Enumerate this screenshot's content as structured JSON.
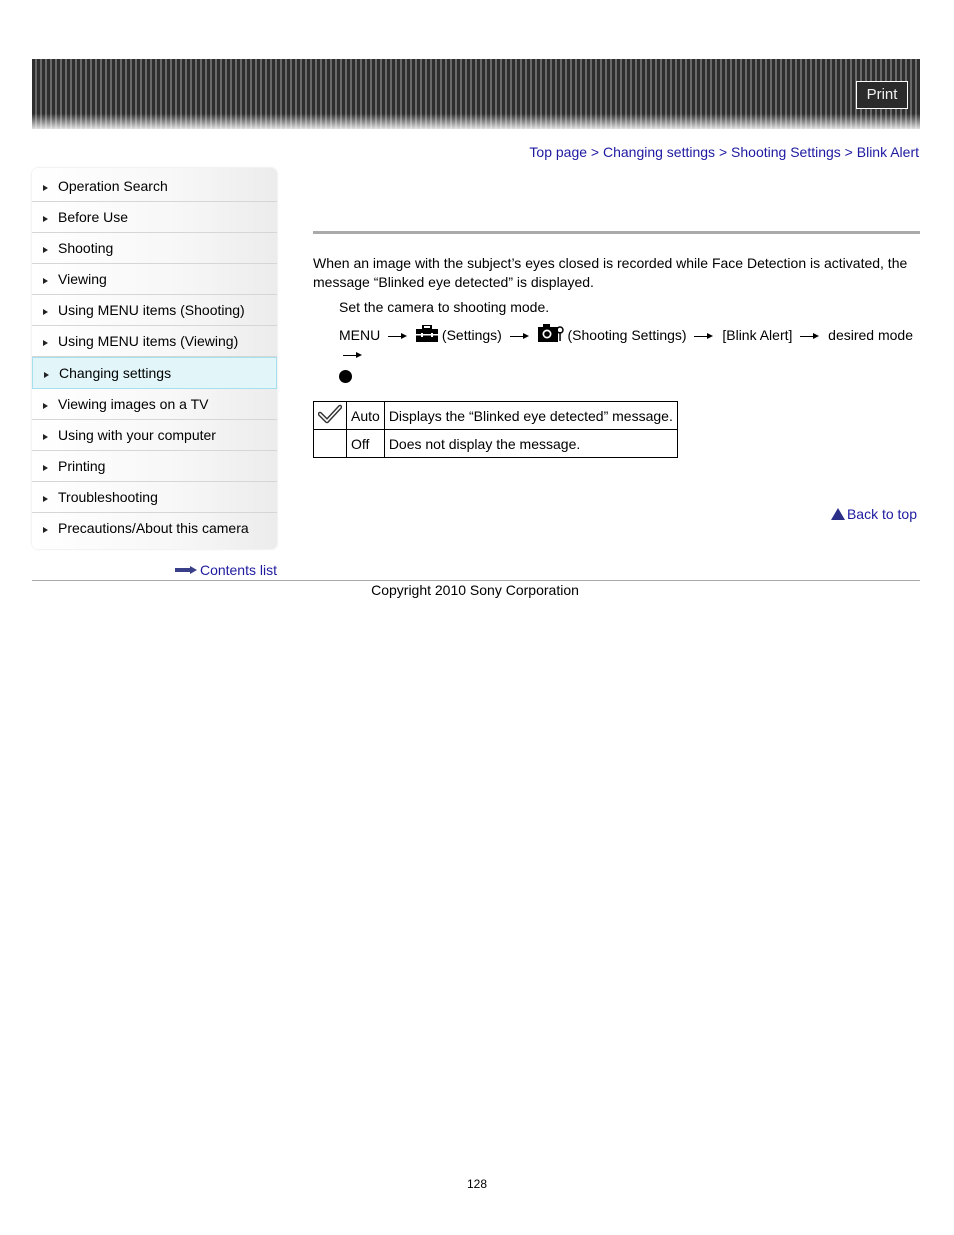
{
  "header": {
    "print_label": "Print"
  },
  "breadcrumb": {
    "items": [
      "Top page",
      "Changing settings",
      "Shooting Settings",
      "Blink Alert"
    ],
    "separator": ">"
  },
  "sidebar": {
    "items": [
      {
        "label": "Operation Search",
        "active": false
      },
      {
        "label": "Before Use",
        "active": false
      },
      {
        "label": "Shooting",
        "active": false
      },
      {
        "label": "Viewing",
        "active": false
      },
      {
        "label": "Using MENU items (Shooting)",
        "active": false
      },
      {
        "label": "Using MENU items (Viewing)",
        "active": false
      },
      {
        "label": "Changing settings",
        "active": true
      },
      {
        "label": "Viewing images on a TV",
        "active": false
      },
      {
        "label": "Using with your computer",
        "active": false
      },
      {
        "label": "Printing",
        "active": false
      },
      {
        "label": "Troubleshooting",
        "active": false
      },
      {
        "label": "Precautions/About this camera",
        "active": false
      }
    ],
    "contents_link": "Contents list"
  },
  "main": {
    "intro": "When an image with the subject’s eyes closed is recorded while Face Detection is activated, the message “Blinked eye detected” is displayed.",
    "step1": "Set the camera to shooting mode.",
    "step2": {
      "menu": "MENU",
      "settings": "(Settings)",
      "shooting_settings": "(Shooting Settings)",
      "blink_alert": "[Blink Alert]",
      "desired_mode": "desired mode"
    },
    "table": [
      {
        "default": true,
        "mode": "Auto",
        "description": "Displays the “Blinked eye detected” message."
      },
      {
        "default": false,
        "mode": "Off",
        "description": "Does not display the message."
      }
    ],
    "back_to_top": "Back to top"
  },
  "footer": {
    "copyright": "Copyright 2010 Sony Corporation",
    "page_number": "128"
  }
}
